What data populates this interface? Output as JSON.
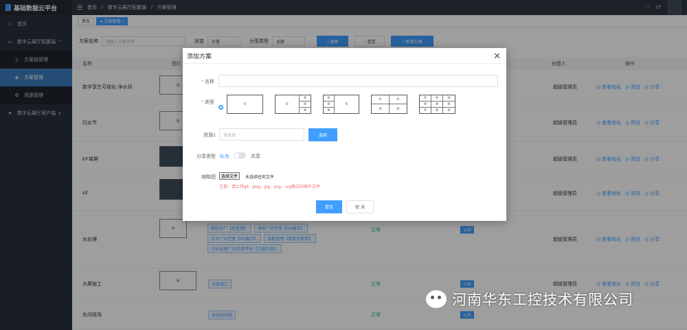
{
  "app": {
    "title": "基础数据云平台"
  },
  "sidebar": {
    "items": [
      {
        "label": "首页",
        "icon": "home-icon"
      },
      {
        "label": "数字云展厅配置端",
        "icon": "monitor-icon"
      },
      {
        "label": "方案组管理",
        "icon": "book-icon"
      },
      {
        "label": "方案管理",
        "icon": "layers-icon"
      },
      {
        "label": "资源管理",
        "icon": "gear-icon"
      },
      {
        "label": "数字云展厅客户端",
        "icon": "send-icon"
      }
    ]
  },
  "header": {
    "breadcrumb": [
      "首页",
      "/",
      "数字云展厅配置端",
      "/",
      "方案管理"
    ],
    "fullscreen_icon": "fullscreen-icon",
    "font_icon": "font-size-icon"
  },
  "tabs": [
    {
      "label": "首页"
    },
    {
      "label": "● 方案管理 ×"
    }
  ],
  "filters": {
    "name_label": "方案名称",
    "name_placeholder": "请输入方案名称",
    "status_label": "状态",
    "status_value": "正常",
    "share_label": "分享类型",
    "share_value": "全部",
    "search_btn": "○ 搜索",
    "reset_btn": "○ 重置",
    "add_btn": "+ 新增方案"
  },
  "table": {
    "headers": [
      "名称",
      "图片",
      "创建人",
      "操作"
    ],
    "rows": [
      {
        "name": "数字孪生可视化-净水间",
        "thumb": "①",
        "tags": [],
        "status": "",
        "share": "",
        "creator": "超级管理员"
      },
      {
        "name": "妇女节",
        "thumb": "①",
        "tags": [],
        "status": "",
        "share": "",
        "creator": "超级管理员"
      },
      {
        "name": "KF单屏",
        "thumb": "",
        "tags": [],
        "status": "",
        "share": "",
        "creator": "超级管理员"
      },
      {
        "name": "KF",
        "thumb": "",
        "tags": [],
        "status": "",
        "share": "",
        "creator": "超级管理员"
      },
      {
        "name": "水处理",
        "thumb": "",
        "tags": [
          "朝阳水厂【水处理】",
          "净水厂中控室【VR展示】",
          "污水厂中控室【VR展示】",
          "智能管理【数智化配电】",
          "污水处理厂3D仿真平台【三维仿真】"
        ],
        "status": "正常",
        "share": "公共",
        "creator": "超级管理员"
      },
      {
        "name": "大屏施工",
        "thumb": "①",
        "tags": [
          "大屏施工"
        ],
        "status": "正常",
        "share": "公共",
        "creator": "超级管理员"
      },
      {
        "name": "车间现场",
        "thumb": "",
        "tags": [
          "车间现场图"
        ],
        "status": "正常",
        "share": "公共",
        "creator": ""
      }
    ],
    "ops": [
      "◎ 查看地址",
      "◎ 预览",
      "◎ 分享"
    ]
  },
  "dialog": {
    "title": "添加方案",
    "name_label": "名称",
    "type_label": "类型",
    "layouts": [
      {
        "cells": [
          "①"
        ]
      },
      {
        "cells": [
          "①",
          "②",
          "③",
          "④"
        ]
      },
      {
        "cells": [
          "②",
          "③",
          "④",
          "①"
        ]
      },
      {
        "cells": [
          "①",
          "②",
          "③",
          "④"
        ]
      },
      {
        "cells": [
          "①",
          "②",
          "③",
          "④",
          "⑤",
          "⑥",
          "⑦",
          "⑧",
          "⑨"
        ]
      }
    ],
    "resource_label": "资源1",
    "resource_placeholder": "请选择",
    "select_btn": "选择",
    "share_label": "分享类型",
    "share_private": "私有",
    "share_public": "共享",
    "thumb_label": "缩略图",
    "file_btn": "选择文件",
    "file_status": "未选择任何文件",
    "note": "注意：请上传gif、jpeg、jpg、png、svg格式的图片文件",
    "submit_btn": "提交",
    "cancel_btn": "取 消"
  },
  "watermark": {
    "text": "河南华东工控技术有限公司"
  },
  "colors": {
    "primary": "#409eff",
    "sidebar": "#29313b",
    "danger": "#f56c6c",
    "success": "#19be6b"
  }
}
